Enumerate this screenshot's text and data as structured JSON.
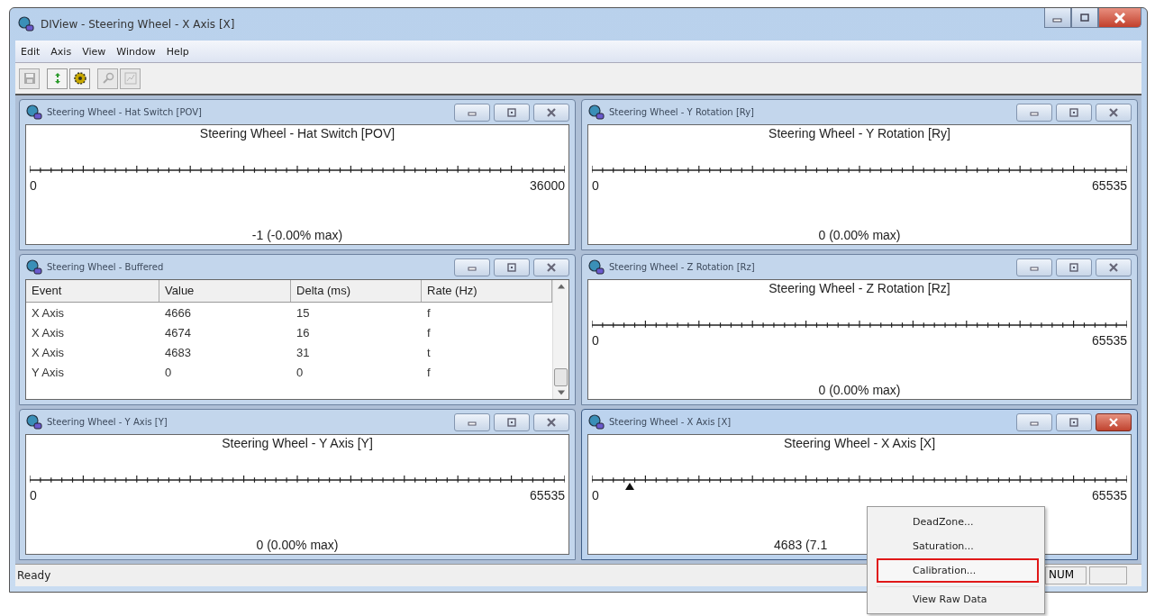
{
  "window": {
    "title": "DIView - Steering Wheel - X Axis [X]"
  },
  "menu": [
    "Edit",
    "Axis",
    "View",
    "Window",
    "Help"
  ],
  "toolbar": [
    {
      "kind": "save",
      "disabled": true
    },
    {
      "kind": "refresh",
      "disabled": false
    },
    {
      "kind": "gear",
      "disabled": false
    },
    {
      "kind": "search",
      "disabled": true
    },
    {
      "kind": "chart",
      "disabled": true
    }
  ],
  "panels": [
    {
      "kind": "axis",
      "title": "Steering Wheel - Hat Switch [POV]",
      "active": false,
      "plot_title": "Steering Wheel - Hat Switch [POV]",
      "min": "0",
      "max": "36000",
      "reading": "-1 (-0.00% max)"
    },
    {
      "kind": "axis",
      "title": "Steering Wheel - Y Rotation [Ry]",
      "active": false,
      "plot_title": "Steering Wheel - Y Rotation [Ry]",
      "min": "0",
      "max": "65535",
      "reading": "0 (0.00% max)"
    },
    {
      "kind": "table",
      "title": "Steering Wheel - Buffered",
      "active": false,
      "columns": [
        "Event",
        "Value",
        "Delta (ms)",
        "Rate (Hz)"
      ],
      "rows": [
        [
          "X Axis",
          "4666",
          "15",
          "f"
        ],
        [
          "X Axis",
          "4674",
          "16",
          "f"
        ],
        [
          "X Axis",
          "4683",
          "31",
          "t"
        ],
        [
          "Y Axis",
          "0",
          "0",
          "f"
        ]
      ]
    },
    {
      "kind": "axis",
      "title": "Steering Wheel - Z Rotation [Rz]",
      "active": false,
      "plot_title": "Steering Wheel - Z Rotation [Rz]",
      "min": "0",
      "max": "65535",
      "reading": "0 (0.00% max)"
    },
    {
      "kind": "axis",
      "title": "Steering Wheel - Y Axis [Y]",
      "active": false,
      "plot_title": "Steering Wheel - Y Axis [Y]",
      "min": "0",
      "max": "65535",
      "reading": "0 (0.00% max)"
    },
    {
      "kind": "axis",
      "title": "Steering Wheel - X Axis [X]",
      "active": true,
      "plot_title": "Steering Wheel - X Axis [X]",
      "min": "0",
      "max": "65535",
      "reading": "4683 (7.1",
      "level": 0.0715
    }
  ],
  "status_bar": {
    "text": "Ready",
    "indicators": [
      "NUM"
    ]
  },
  "context_menu": [
    {
      "label": "DeadZone...",
      "selected": false
    },
    {
      "label": "Saturation...",
      "selected": false
    },
    {
      "label": "Calibration...",
      "selected": true
    },
    {
      "label": "View Raw Data",
      "selected": false
    }
  ]
}
